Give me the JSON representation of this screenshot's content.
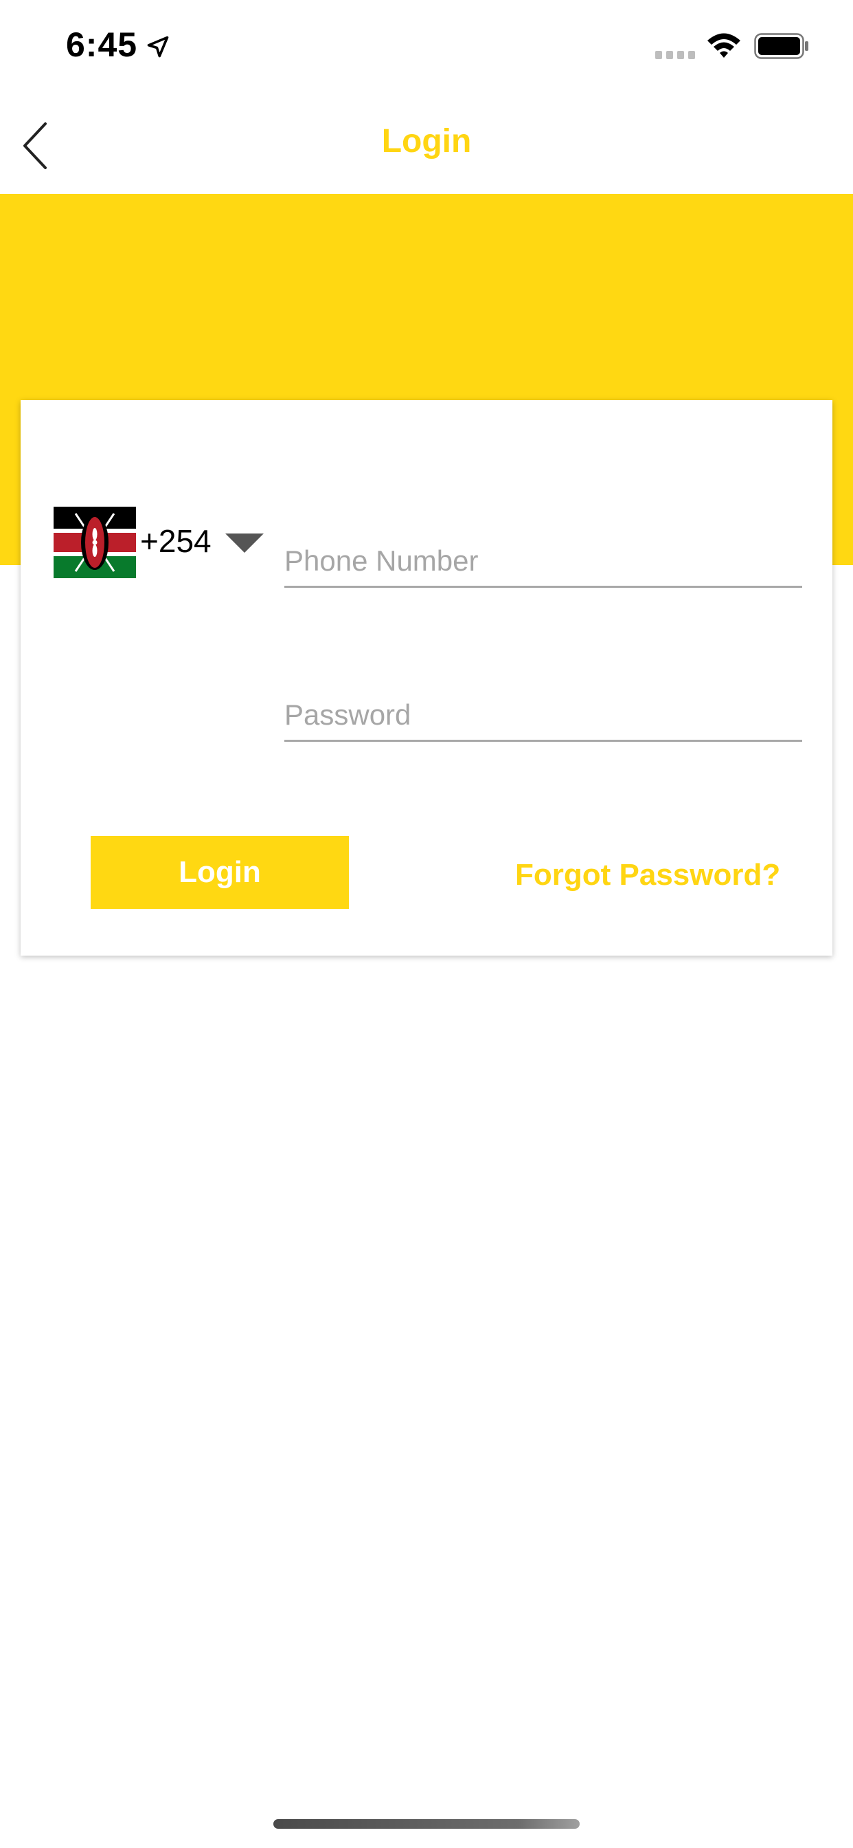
{
  "status_bar": {
    "time": "6:45",
    "icons": [
      "location-arrow-icon",
      "signal-icon",
      "wifi-icon",
      "battery-icon"
    ]
  },
  "nav": {
    "title": "Login",
    "back_icon": "chevron-left-icon"
  },
  "colors": {
    "accent": "#FFD812",
    "title_text": "#FFD512",
    "placeholder": "#A6A6A6",
    "input_underline": "#A8A8A8"
  },
  "form": {
    "country": {
      "flag": "kenya-flag-icon",
      "code": "+254",
      "dropdown_icon": "caret-down-icon"
    },
    "phone": {
      "placeholder": "Phone Number",
      "value": ""
    },
    "password": {
      "placeholder": "Password",
      "value": ""
    },
    "login_label": "Login",
    "forgot_label": "Forgot Password?"
  }
}
